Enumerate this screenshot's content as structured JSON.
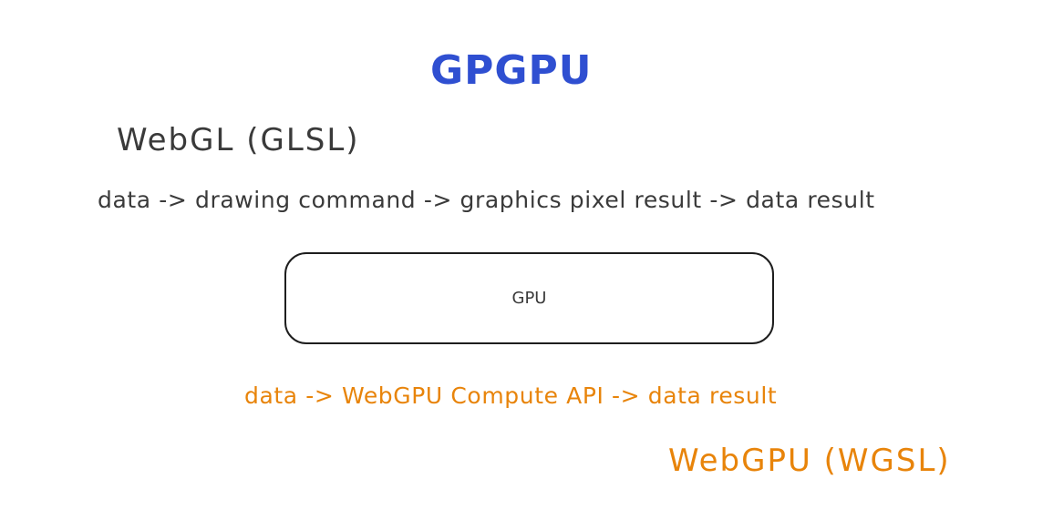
{
  "title": {
    "text": "GPGPU",
    "color": "#2f4fd1"
  },
  "webgl": {
    "label": "WebGL (GLSL)",
    "color": "#3a3a3a",
    "flow": "data -> drawing command -> graphics pixel result -> data result"
  },
  "gpu_box": {
    "label": "GPU"
  },
  "webgpu": {
    "label": "WebGPU (WGSL)",
    "color": "#e8840a",
    "flow": "data -> WebGPU Compute API -> data result"
  }
}
